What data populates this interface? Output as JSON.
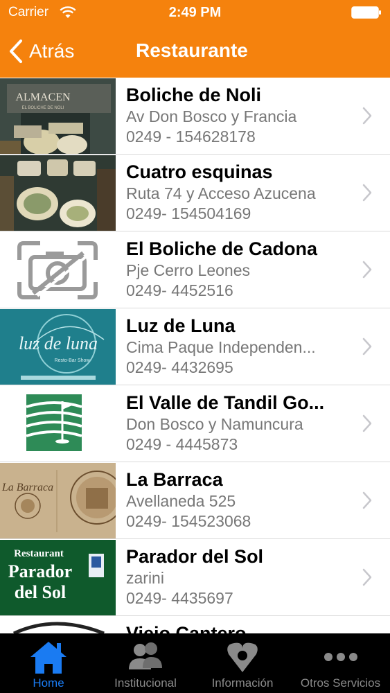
{
  "status_bar": {
    "carrier": "Carrier",
    "time": "2:49 PM"
  },
  "nav": {
    "back_label": "Atrás",
    "title": "Restaurante"
  },
  "items": [
    {
      "name": "Boliche de Noli",
      "address": "Av Don Bosco y Francia",
      "phone": "0249 - 154628178"
    },
    {
      "name": "Cuatro esquinas",
      "address": "Ruta 74 y Acceso Azucena",
      "phone": "0249- 154504169"
    },
    {
      "name": "El Boliche de Cadona",
      "address": "Pje Cerro Leones",
      "phone": "0249- 4452516"
    },
    {
      "name": "Luz de Luna",
      "address": "Cima Paque Independen...",
      "phone": "0249- 4432695"
    },
    {
      "name": "El Valle de Tandil Go...",
      "address": "Don Bosco y Namuncura",
      "phone": "0249 - 4445873"
    },
    {
      "name": "La Barraca",
      "address": "Avellaneda 525",
      "phone": "0249- 154523068"
    },
    {
      "name": "Parador del Sol",
      "address": "zarini",
      "phone": "0249- 4435697"
    },
    {
      "name": "Viejo Cantero",
      "address": "",
      "phone": ""
    }
  ],
  "thumb_text": {
    "almacen": "ALMACEN",
    "almacen_sub": "EL BOLICHE DE NOLI",
    "luz": "luz de luna",
    "luz_sub": "Resto-Bar Show",
    "barraca": "La Barraca",
    "parador_top": "Restaurant",
    "parador_mid": "Parador",
    "parador_bot": "del Sol"
  },
  "tabs": [
    {
      "label": "Home",
      "icon": "home-icon",
      "active": true
    },
    {
      "label": "Institucional",
      "icon": "people-icon",
      "active": false
    },
    {
      "label": "Información",
      "icon": "info-marker-icon",
      "active": false
    },
    {
      "label": "Otros Servicios",
      "icon": "more-dots-icon",
      "active": false
    }
  ],
  "colors": {
    "header": "#f5820d",
    "tab_active": "#1a7bf2",
    "tab_inactive": "#8a8a8a"
  }
}
